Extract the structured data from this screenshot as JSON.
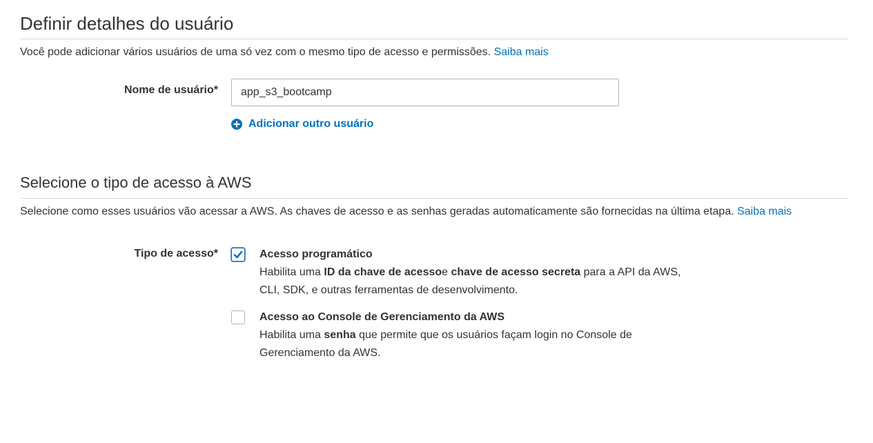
{
  "user_details": {
    "title": "Definir detalhes do usuário",
    "description": "Você pode adicionar vários usuários de uma só vez com o mesmo tipo de acesso e permissões.",
    "learn_more": "Saiba mais",
    "username_label": "Nome de usuário*",
    "username_value": "app_s3_bootcamp",
    "add_user_label": "Adicionar outro usuário"
  },
  "access_type": {
    "title": "Selecione o tipo de acesso à AWS",
    "description": "Selecione como esses usuários vão acessar a AWS. As chaves de acesso e as senhas geradas automaticamente são fornecidas na última etapa.",
    "learn_more": "Saiba mais",
    "field_label": "Tipo de acesso*",
    "options": [
      {
        "title": "Acesso programático",
        "checked": true,
        "desc_prefix": "Habilita uma ",
        "desc_bold_1": "ID da chave de acesso",
        "desc_mid": "e ",
        "desc_bold_2": "chave de acesso secreta",
        "desc_suffix_line1": " para a API da AWS,",
        "desc_line2": "CLI, SDK, e outras ferramentas de desenvolvimento."
      },
      {
        "title": "Acesso ao Console de Gerenciamento da AWS",
        "checked": false,
        "desc_prefix": "Habilita uma ",
        "desc_bold_1": "senha",
        "desc_suffix_line1": " que permite que os usuários façam login no Console de",
        "desc_line2": "Gerenciamento da AWS."
      }
    ]
  },
  "colors": {
    "link": "#0073bb",
    "text": "#333333",
    "divider": "#d5dbdb",
    "checkbox_checked": "#1b6fb5"
  }
}
